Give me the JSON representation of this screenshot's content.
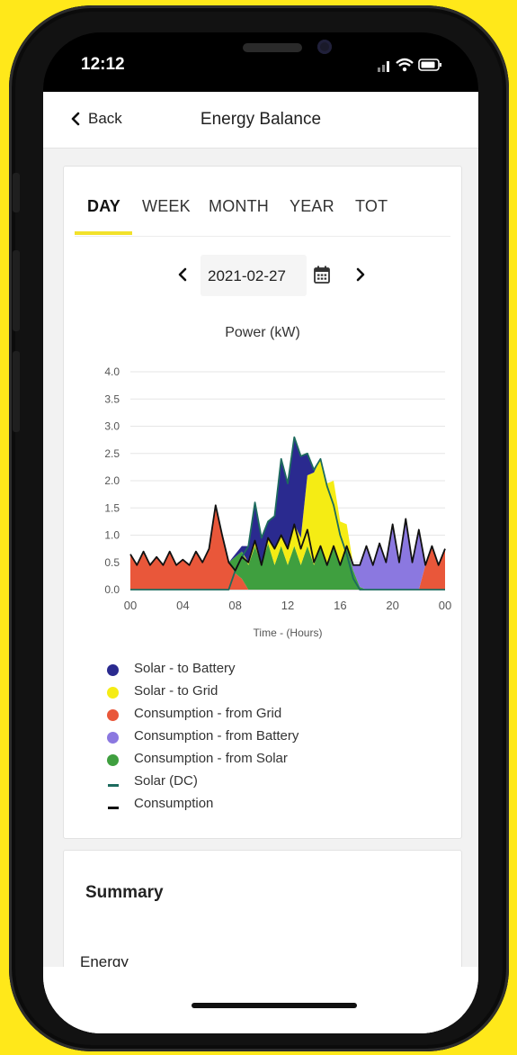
{
  "status_bar": {
    "time": "12:12"
  },
  "nav": {
    "back_label": "Back",
    "title": "Energy Balance"
  },
  "tabs": [
    {
      "label": "DAY",
      "active": true
    },
    {
      "label": "WEEK",
      "active": false
    },
    {
      "label": "MONTH",
      "active": false
    },
    {
      "label": "YEAR",
      "active": false
    },
    {
      "label": "TOT",
      "active": false
    }
  ],
  "date": {
    "value": "2021-02-27"
  },
  "colors": {
    "solar_to_battery": "#2a2a8f",
    "solar_to_grid": "#f5ec14",
    "consumption_from_grid": "#e9573a",
    "consumption_from_battery": "#8b78e0",
    "consumption_from_solar": "#3f9f3f",
    "solar_dc_line": "#1d6b5e",
    "consumption_line": "#111111",
    "accent": "#f2e12b"
  },
  "chart_data": {
    "type": "area",
    "title": "Power (kW)",
    "xlabel": "Time - (Hours)",
    "ylabel": "",
    "ylim": [
      0,
      4
    ],
    "xlim": [
      0,
      24
    ],
    "yticks": [
      "0.0",
      "0.5",
      "1.0",
      "1.5",
      "2.0",
      "2.5",
      "3.0",
      "3.5",
      "4.0"
    ],
    "xticks": [
      "00",
      "04",
      "08",
      "12",
      "16",
      "20",
      "00"
    ],
    "grid": true,
    "x": [
      0,
      0.5,
      1,
      1.5,
      2,
      2.5,
      3,
      3.5,
      4,
      4.5,
      5,
      5.5,
      6,
      6.5,
      7,
      7.5,
      8,
      8.5,
      9,
      9.5,
      10,
      10.5,
      11,
      11.5,
      12,
      12.5,
      13,
      13.5,
      14,
      14.5,
      15,
      15.5,
      16,
      16.5,
      17,
      17.5,
      18,
      18.5,
      19,
      19.5,
      20,
      20.5,
      21,
      21.5,
      22,
      22.5,
      23,
      23.5,
      24
    ],
    "series": [
      {
        "name": "Solar - to Battery",
        "values": [
          0,
          0,
          0,
          0,
          0,
          0,
          0,
          0,
          0,
          0,
          0,
          0,
          0,
          0,
          0,
          0,
          0.05,
          0.1,
          0.3,
          0.7,
          0.5,
          0.3,
          0.6,
          1.4,
          1.2,
          1.6,
          1.5,
          0.4,
          0.05,
          0,
          0,
          0,
          0,
          0,
          0,
          0,
          0,
          0,
          0,
          0,
          0,
          0,
          0,
          0,
          0,
          0,
          0,
          0,
          0
        ]
      },
      {
        "name": "Solar - to Grid",
        "values": [
          0,
          0,
          0,
          0,
          0,
          0,
          0,
          0,
          0,
          0,
          0,
          0,
          0,
          0,
          0,
          0,
          0,
          0,
          0.05,
          0.1,
          0,
          0.1,
          0.3,
          0.2,
          0.3,
          0.4,
          0.5,
          1.3,
          1.7,
          1.6,
          1.5,
          1.2,
          0.8,
          0.4,
          0,
          0,
          0,
          0,
          0,
          0,
          0,
          0,
          0,
          0,
          0,
          0,
          0,
          0,
          0
        ]
      },
      {
        "name": "Consumption - from Grid",
        "values": [
          0.65,
          0.45,
          0.7,
          0.45,
          0.6,
          0.45,
          0.7,
          0.45,
          0.55,
          0.45,
          0.7,
          0.5,
          0.75,
          1.55,
          1.0,
          0.5,
          0.3,
          0.2,
          0,
          0,
          0,
          0,
          0,
          0,
          0,
          0,
          0,
          0,
          0,
          0,
          0,
          0,
          0,
          0,
          0,
          0,
          0,
          0,
          0,
          0,
          0,
          0,
          0,
          0,
          0,
          0.45,
          0.8,
          0.45,
          0.75
        ]
      },
      {
        "name": "Consumption - from Battery",
        "values": [
          0,
          0,
          0,
          0,
          0,
          0,
          0,
          0,
          0,
          0,
          0,
          0,
          0,
          0,
          0,
          0,
          0,
          0,
          0,
          0,
          0,
          0,
          0,
          0,
          0,
          0,
          0,
          0,
          0,
          0,
          0,
          0,
          0,
          0,
          0.1,
          0.4,
          0.8,
          0.45,
          0.85,
          0.5,
          1.2,
          0.5,
          1.3,
          0.5,
          1.1,
          0,
          0,
          0,
          0
        ]
      },
      {
        "name": "Consumption - from Solar",
        "values": [
          0,
          0,
          0,
          0,
          0,
          0,
          0,
          0,
          0,
          0,
          0,
          0,
          0,
          0,
          0,
          0,
          0.3,
          0.5,
          0.45,
          0.8,
          0.45,
          0.85,
          0.45,
          0.8,
          0.45,
          0.8,
          0.45,
          0.8,
          0.45,
          0.8,
          0.45,
          0.8,
          0.45,
          0.8,
          0.35,
          0.05,
          0,
          0,
          0,
          0,
          0,
          0,
          0,
          0,
          0,
          0,
          0,
          0,
          0
        ]
      },
      {
        "name": "Solar (DC)",
        "values": [
          0,
          0,
          0,
          0,
          0,
          0,
          0,
          0,
          0,
          0,
          0,
          0,
          0,
          0,
          0,
          0,
          0.35,
          0.6,
          0.8,
          1.6,
          0.95,
          1.25,
          1.35,
          2.4,
          1.95,
          2.8,
          2.45,
          2.5,
          2.2,
          2.4,
          1.9,
          1.55,
          1.0,
          0.65,
          0.2,
          0,
          0,
          0,
          0,
          0,
          0,
          0,
          0,
          0,
          0,
          0,
          0,
          0,
          0
        ]
      },
      {
        "name": "Consumption",
        "values": [
          0.65,
          0.45,
          0.7,
          0.45,
          0.6,
          0.45,
          0.7,
          0.45,
          0.55,
          0.45,
          0.7,
          0.5,
          0.75,
          1.55,
          1.0,
          0.5,
          0.35,
          0.6,
          0.5,
          0.9,
          0.45,
          0.95,
          0.75,
          1.0,
          0.75,
          1.2,
          0.75,
          1.1,
          0.5,
          0.8,
          0.45,
          0.8,
          0.45,
          0.8,
          0.45,
          0.45,
          0.8,
          0.45,
          0.85,
          0.5,
          1.2,
          0.5,
          1.3,
          0.5,
          1.1,
          0.45,
          0.8,
          0.45,
          0.75
        ]
      }
    ]
  },
  "legend": [
    {
      "label": "Solar - to Battery",
      "kind": "dot",
      "color": "#2a2a8f"
    },
    {
      "label": "Solar - to Grid",
      "kind": "dot",
      "color": "#f5ec14"
    },
    {
      "label": "Consumption - from Grid",
      "kind": "dot",
      "color": "#e9573a"
    },
    {
      "label": "Consumption - from Battery",
      "kind": "dot",
      "color": "#8b78e0"
    },
    {
      "label": "Consumption - from Solar",
      "kind": "dot",
      "color": "#3f9f3f"
    },
    {
      "label": "Solar (DC)",
      "kind": "line",
      "color": "#1d6b5e"
    },
    {
      "label": "Consumption",
      "kind": "line",
      "color": "#111111"
    }
  ],
  "summary": {
    "title": "Summary",
    "energy_label": "Energy"
  }
}
